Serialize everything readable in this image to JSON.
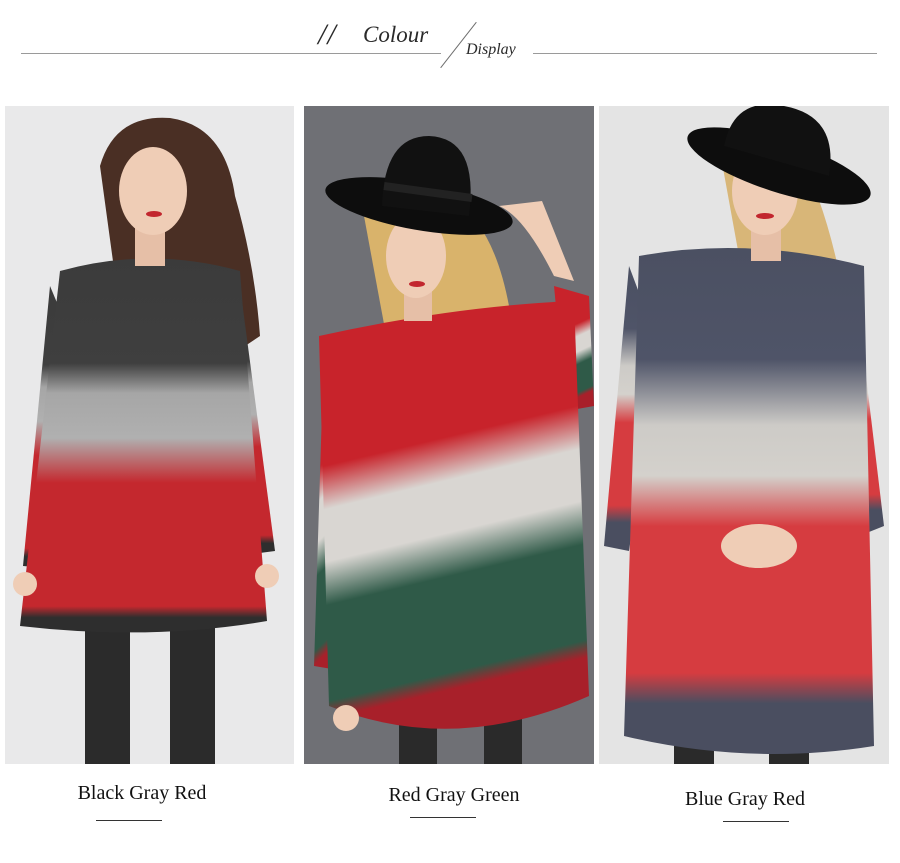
{
  "header": {
    "marks": "//",
    "title": "Colour",
    "subtitle": "Display"
  },
  "variants": [
    {
      "caption": "Black Gray Red",
      "colors": [
        "#3b3b3b",
        "#a6a6a6",
        "#c4282e",
        "#2e2e2e"
      ]
    },
    {
      "caption": "Red Gray Green",
      "colors": [
        "#c8232b",
        "#d9d6d2",
        "#2f5a48",
        "#a8202a"
      ]
    },
    {
      "caption": "Blue Gray Red",
      "colors": [
        "#4b5062",
        "#cdcbc7",
        "#d63c40",
        "#4a4e60"
      ]
    }
  ]
}
